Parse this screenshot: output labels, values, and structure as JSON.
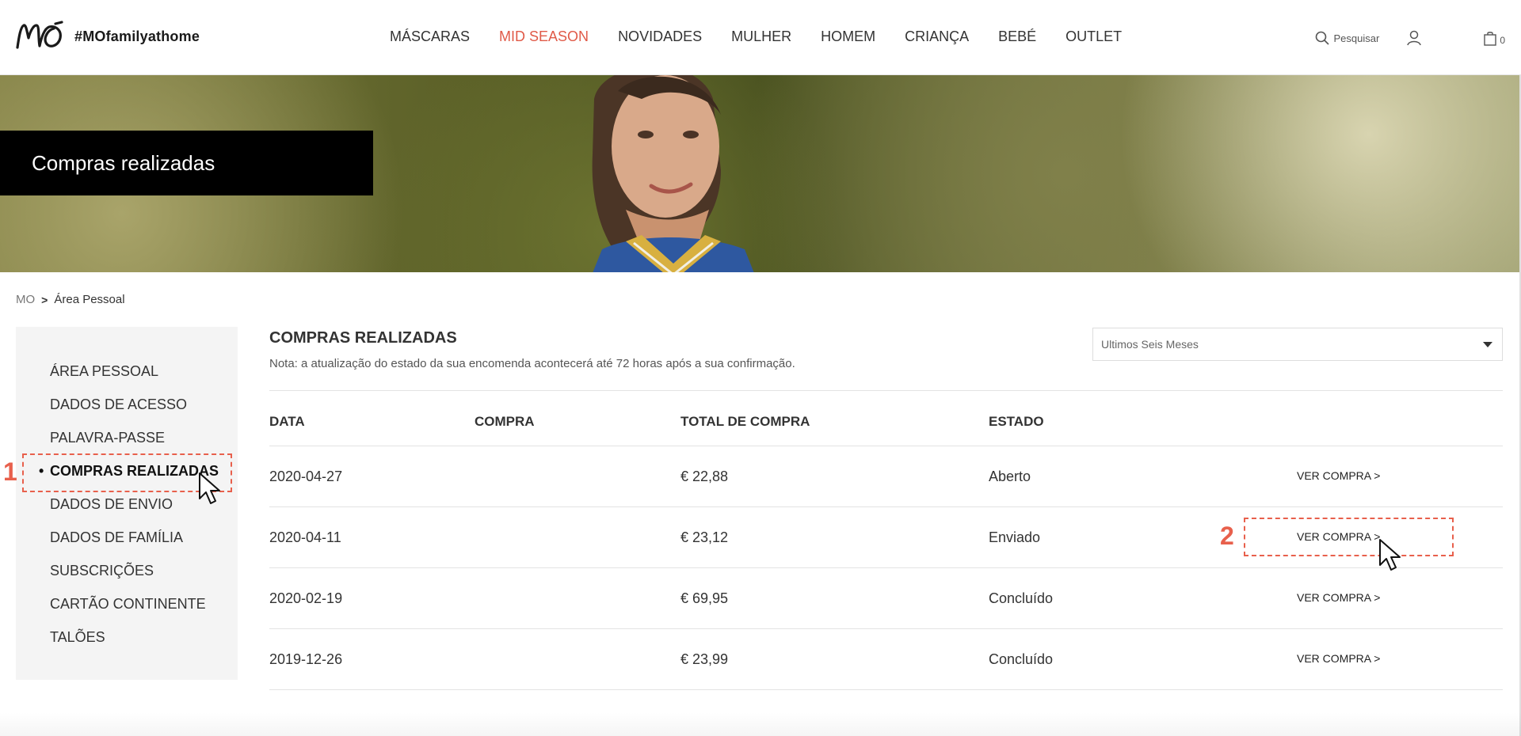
{
  "header": {
    "logo_text": "MO",
    "hashtag": "#MOfamilyathome",
    "nav": [
      {
        "label": "MÁSCARAS",
        "accent": false
      },
      {
        "label": "MID SEASON",
        "accent": true
      },
      {
        "label": "NOVIDADES",
        "accent": false
      },
      {
        "label": "MULHER",
        "accent": false
      },
      {
        "label": "HOMEM",
        "accent": false
      },
      {
        "label": "CRIANÇA",
        "accent": false
      },
      {
        "label": "BEBÉ",
        "accent": false
      },
      {
        "label": "OUTLET",
        "accent": false
      }
    ],
    "search_label": "Pesquisar",
    "bag_count": "0"
  },
  "hero": {
    "title": "Compras realizadas"
  },
  "breadcrumb": {
    "home": "MO",
    "separator": ">",
    "current": "Área Pessoal"
  },
  "sidebar": {
    "items": [
      {
        "label": "ÁREA PESSOAL",
        "active": false
      },
      {
        "label": "DADOS DE ACESSO",
        "active": false
      },
      {
        "label": "PALAVRA-PASSE",
        "active": false
      },
      {
        "label": "COMPRAS REALIZADAS",
        "active": true
      },
      {
        "label": "DADOS DE ENVIO",
        "active": false
      },
      {
        "label": "DADOS DE FAMÍLIA",
        "active": false
      },
      {
        "label": "SUBSCRIÇÕES",
        "active": false
      },
      {
        "label": "CARTÃO CONTINENTE",
        "active": false
      },
      {
        "label": "TALÕES",
        "active": false
      }
    ],
    "bullet": "•"
  },
  "main": {
    "title": "COMPRAS REALIZADAS",
    "note": "Nota: a atualização do estado da sua encomenda acontecerá até 72 horas após a sua confirmação.",
    "period_select": "Ultimos Seis Meses",
    "table": {
      "headers": [
        "DATA",
        "COMPRA",
        "TOTAL DE COMPRA",
        "ESTADO"
      ],
      "rows": [
        {
          "date": "2020-04-27",
          "compra": "",
          "total": "€ 22,88",
          "estado": "Aberto",
          "action": "VER COMPRA >"
        },
        {
          "date": "2020-04-11",
          "compra": "",
          "total": "€ 23,12",
          "estado": "Enviado",
          "action": "VER COMPRA >"
        },
        {
          "date": "2020-02-19",
          "compra": "",
          "total": "€ 69,95",
          "estado": "Concluído",
          "action": "VER COMPRA >"
        },
        {
          "date": "2019-12-26",
          "compra": "",
          "total": "€ 23,99",
          "estado": "Concluído",
          "action": "VER COMPRA >"
        }
      ]
    }
  },
  "annotations": {
    "step1": "1",
    "step2": "2",
    "color": "#e8604c"
  },
  "colors": {
    "accent": "#e05a48",
    "hero_box": "#000000",
    "sidebar_bg": "#f4f4f4"
  }
}
